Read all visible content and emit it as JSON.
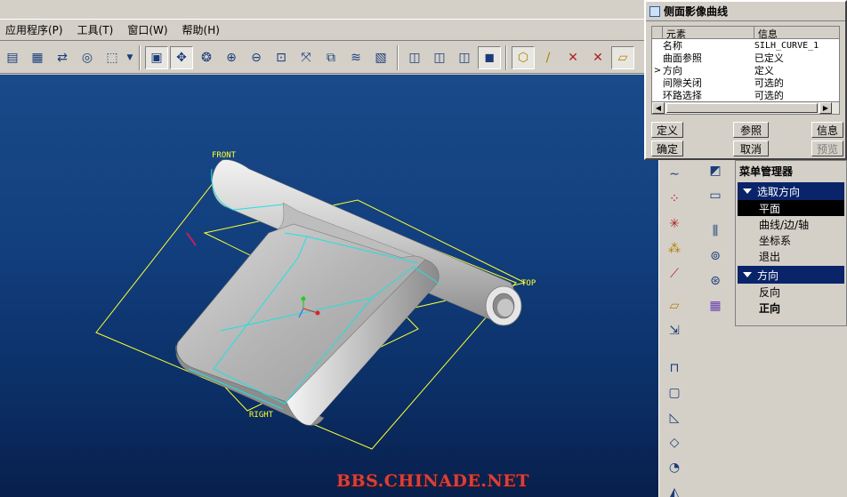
{
  "menubar": {
    "items": [
      "应用程序(P)",
      "工具(T)",
      "窗口(W)",
      "帮助(H)"
    ]
  },
  "dialog": {
    "title": "侧面影像曲线",
    "columns": [
      "元素",
      "信息"
    ],
    "rows": [
      {
        "element": "名称",
        "info": "SILH_CURVE_1",
        "current": false
      },
      {
        "element": "曲面参照",
        "info": "已定义",
        "current": false
      },
      {
        "element": "方向",
        "info": "定义",
        "current": true
      },
      {
        "element": "间隙关闭",
        "info": "可选的",
        "current": false
      },
      {
        "element": "环路选择",
        "info": "可选的",
        "current": false
      }
    ],
    "buttons": {
      "define": "定义",
      "reference": "参照",
      "info": "信息",
      "ok": "确定",
      "cancel": "取消",
      "preview": "预览"
    }
  },
  "menu_manager": {
    "title": "菜单管理器",
    "sections": [
      {
        "title": "选取方向",
        "items": [
          {
            "label": "平面",
            "selected": true,
            "bold": false
          },
          {
            "label": "曲线/边/轴",
            "selected": false,
            "bold": false
          },
          {
            "label": "坐标系",
            "selected": false,
            "bold": false
          },
          {
            "label": "退出",
            "selected": false,
            "bold": false
          }
        ]
      },
      {
        "title": "方向",
        "items": [
          {
            "label": "反向",
            "selected": false,
            "bold": false
          },
          {
            "label": "正向",
            "selected": false,
            "bold": true
          }
        ]
      }
    ]
  },
  "viewport": {
    "datum_labels": {
      "front": "FRONT",
      "top": "TOP",
      "right": "RIGHT"
    },
    "background_colors": [
      "#1a4a8a",
      "#081f4c"
    ],
    "datum_color": "#ffff30",
    "edge_highlight_color": "#20e0e0"
  },
  "watermark": "BBS.CHINADE.NET"
}
